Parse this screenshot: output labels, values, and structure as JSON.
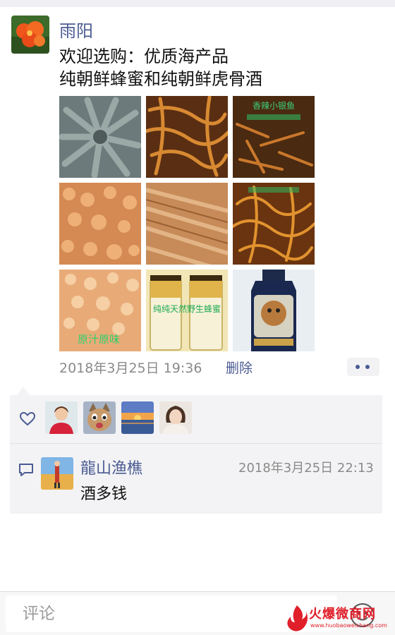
{
  "post": {
    "author": "雨阳",
    "message": "欢迎选购：优质海产品\n纯朝鲜蜂蜜和纯朝鲜虎骨酒",
    "timestamp": "2018年3月25日 19:36",
    "delete_label": "删除",
    "photos": [
      {
        "subject": "sea-cucumber",
        "caption": ""
      },
      {
        "subject": "dried-squid-strips",
        "caption": ""
      },
      {
        "subject": "spicy-fish",
        "caption": "香辣小银鱼"
      },
      {
        "subject": "dried-shrimp",
        "caption": ""
      },
      {
        "subject": "dried-fish-fillet",
        "caption": ""
      },
      {
        "subject": "spicy-squid",
        "caption": ""
      },
      {
        "subject": "dried-shrimp-small",
        "caption": "原汁原味"
      },
      {
        "subject": "honey-jars",
        "caption": "纯纯天然野生蜂蜜"
      },
      {
        "subject": "tiger-bone-wine",
        "caption": ""
      }
    ]
  },
  "likes": {
    "icon": "heart-outline-icon",
    "avatars": [
      "woman-red-jacket",
      "cat-photo",
      "sunset-beach",
      "girl-portrait"
    ]
  },
  "comment": {
    "icon": "comment-bubble-icon",
    "author": "龍山渔樵",
    "time": "2018年3月25日 22:13",
    "text": "酒多钱"
  },
  "input": {
    "placeholder": "评论",
    "emoji_icon": "smiley-icon"
  },
  "watermark": {
    "text": "火爆微商网",
    "url": "www.huobaoweishang.com"
  },
  "colors": {
    "link": "#4b5b92",
    "meta": "#8a8a8a",
    "panel": "#f3f3f5"
  }
}
